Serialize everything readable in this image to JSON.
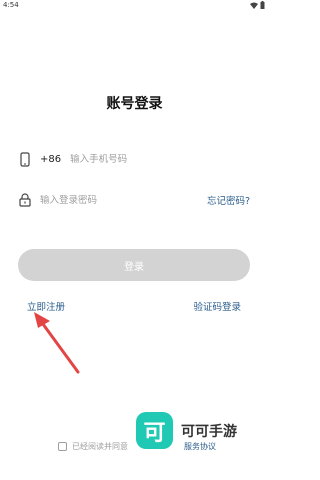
{
  "status_bar": {
    "time": "4:54"
  },
  "title": "账号登录",
  "phone": {
    "prefix": "+86",
    "placeholder": "输入手机号码"
  },
  "password": {
    "placeholder": "输入登录密码",
    "forgot_label": "忘记密码?"
  },
  "login_button": "登录",
  "links": {
    "register": "立即注册",
    "code_login": "验证码登录"
  },
  "agreement": {
    "text": "已经阅读并同意",
    "link": "服务协议"
  },
  "watermark": {
    "logo_char": "可",
    "text": "可可手游"
  },
  "colors": {
    "link": "#2a5d8c",
    "button_disabled": "#d3d3d3",
    "arrow": "#e34545",
    "watermark": "#1fc9b3"
  },
  "icons": [
    "wifi-icon",
    "battery-icon",
    "phone-icon",
    "lock-icon",
    "arrow-annotation-icon"
  ]
}
